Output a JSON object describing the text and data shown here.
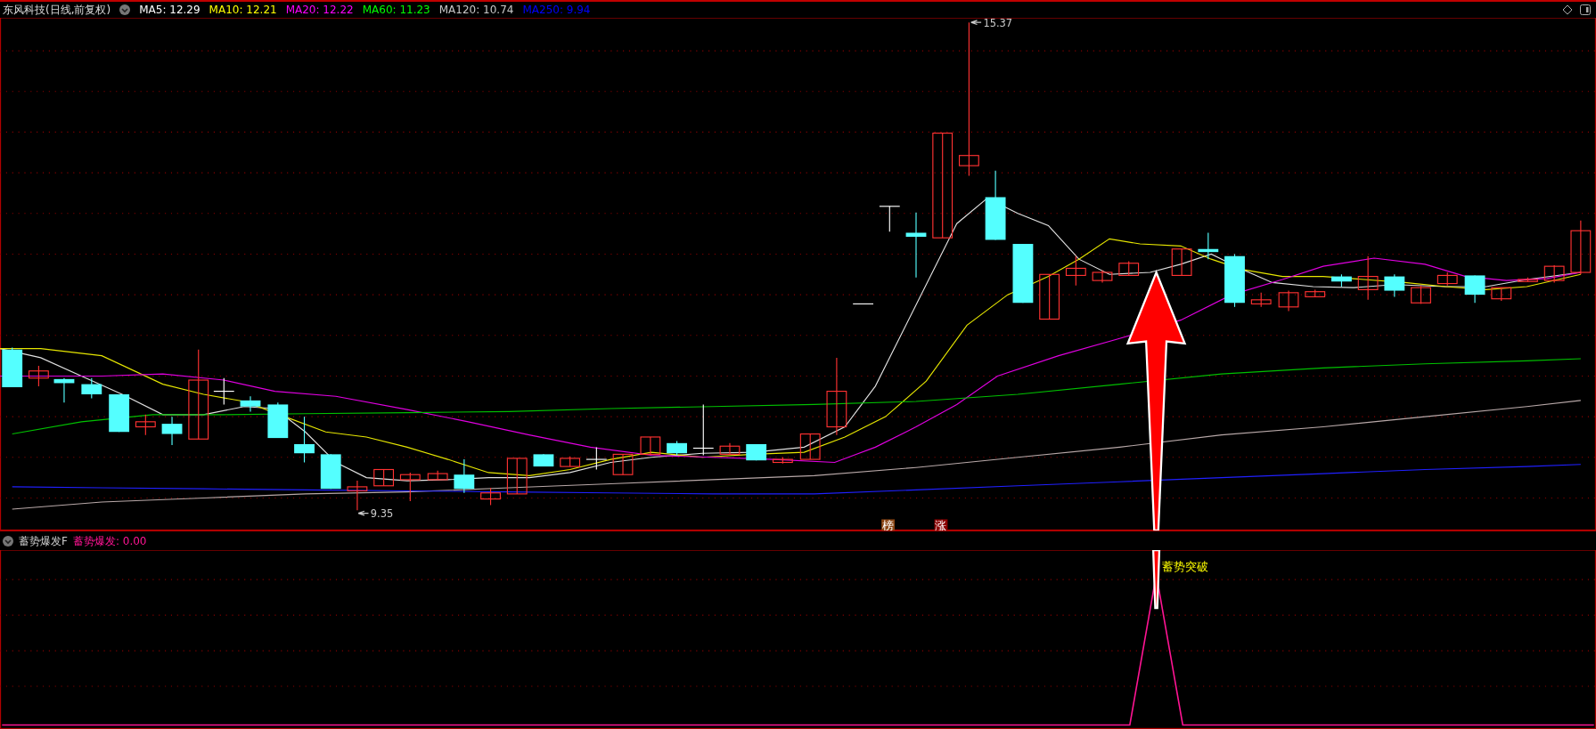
{
  "header": {
    "title": "东风科技(日线,前复权)",
    "moving_averages": [
      {
        "label": "MA5: 12.29",
        "color": "#ffffff"
      },
      {
        "label": "MA10: 12.21",
        "color": "#ffff00"
      },
      {
        "label": "MA20: 12.22",
        "color": "#ff00ff"
      },
      {
        "label": "MA60: 11.23",
        "color": "#00ff00"
      },
      {
        "label": "MA120: 10.74",
        "color": "#c8c8c8"
      },
      {
        "label": "MA250: 9.94",
        "color": "#0000ff"
      }
    ]
  },
  "price_chart": {
    "high_label": "15.37",
    "low_label": "9.35",
    "markers": [
      {
        "text": "榜",
        "color": "#8b4513"
      },
      {
        "text": "涨",
        "color": "#8b0000"
      }
    ]
  },
  "indicator": {
    "name": "蓄势爆发F",
    "value_label": "蓄势爆发: 0.00",
    "signal_label": "蓄势突破"
  }
}
